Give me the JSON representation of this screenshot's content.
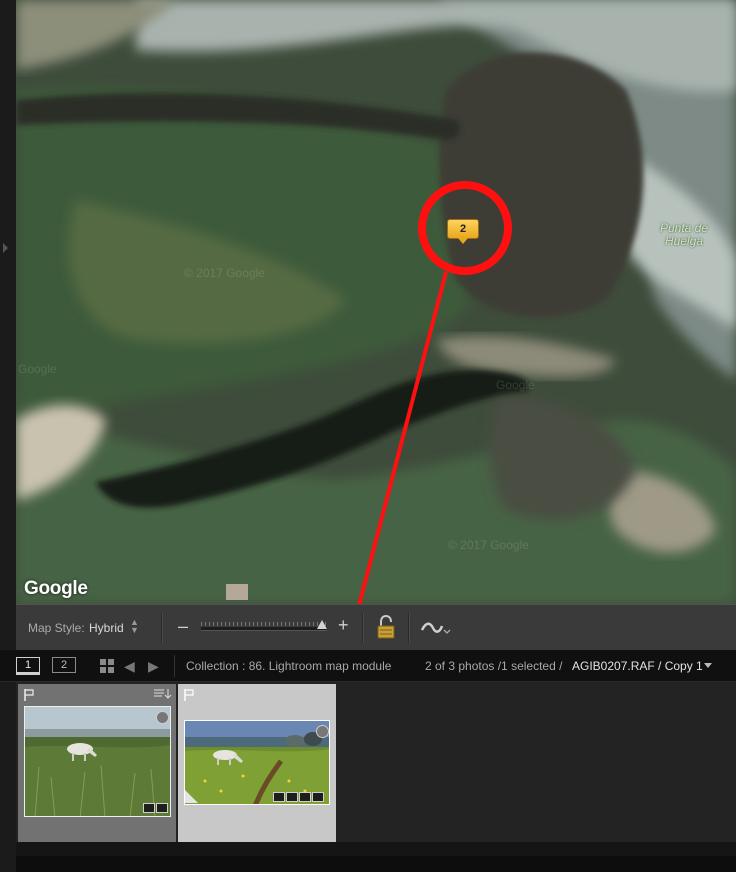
{
  "map": {
    "place_label": "Punta de\nHuelga",
    "watermarks": [
      "© 2017 Google",
      "Google",
      "© 2017 Google",
      "Google"
    ],
    "google_logo": "Google",
    "pin_count": "2",
    "annotation_color": "#ff1010"
  },
  "map_toolbar": {
    "style_label": "Map Style:",
    "style_value": "Hybrid",
    "zoom_out": "–",
    "zoom_in": "+",
    "zoom_level": 0.9
  },
  "film_nav": {
    "screen_1": "1",
    "screen_2": "2",
    "back": "◀",
    "forward": "▶",
    "collection": "Collection : 86. Lightroom map module",
    "count": "2 of 3 photos /1 selected /",
    "filename": "AGIB0207.RAF / Copy 1"
  },
  "filmstrip": {
    "selected_index": 1,
    "cell_colors": {
      "normal": "#727272",
      "selected": "#c8c8c8"
    }
  }
}
